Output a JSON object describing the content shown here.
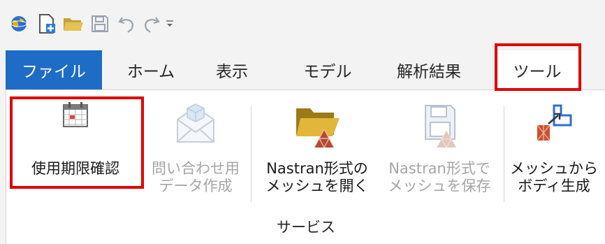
{
  "quick_access": {
    "icons": [
      "app-globe-icon",
      "new-file-icon",
      "open-folder-icon",
      "save-icon",
      "undo-icon",
      "redo-icon",
      "customize-dropdown-icon"
    ]
  },
  "tabs": [
    {
      "label": "ファイル"
    },
    {
      "label": "ホーム"
    },
    {
      "label": "表示"
    },
    {
      "label": "モデル"
    },
    {
      "label": "解析結果"
    },
    {
      "label": "ツール"
    }
  ],
  "ribbon": {
    "group_label": "サービス",
    "commands": [
      {
        "line1": "使用期限確認",
        "line2": "",
        "icon": "calendar-icon",
        "enabled": true
      },
      {
        "line1": "問い合わせ用",
        "line2": "データ作成",
        "icon": "envelope-icon",
        "enabled": false
      },
      {
        "line1": "Nastran形式の",
        "line2": "メッシュを開く",
        "icon": "open-mesh-icon",
        "enabled": true
      },
      {
        "line1": "Nastran形式で",
        "line2": "メッシュを保存",
        "icon": "save-mesh-icon",
        "enabled": false
      },
      {
        "line1": "メッシュから",
        "line2": "ボディ生成",
        "icon": "mesh-to-body-icon",
        "enabled": true
      }
    ]
  },
  "colors": {
    "file_tab": "#1e6cc6",
    "highlight": "#e00000",
    "disabled_text": "#a6a6a6"
  }
}
